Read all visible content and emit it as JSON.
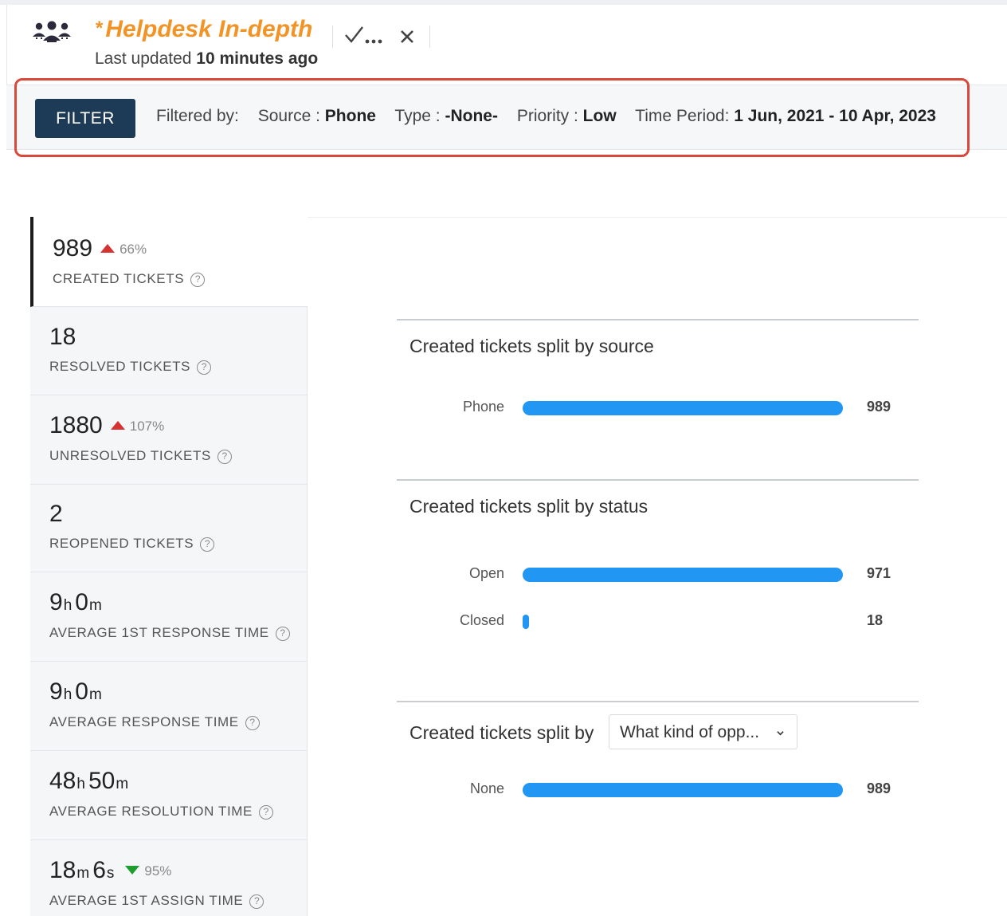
{
  "header": {
    "unsaved_marker": "*",
    "title": "Helpdesk In-depth",
    "updated_prefix": "Last updated",
    "updated_value": "10 minutes ago"
  },
  "filter": {
    "button_label": "FILTER",
    "filtered_by_label": "Filtered by:",
    "items": [
      {
        "label": "Source :",
        "value": "Phone"
      },
      {
        "label": "Type :",
        "value": "-None-"
      },
      {
        "label": "Priority :",
        "value": "Low"
      },
      {
        "label": "Time Period:",
        "value": "1 Jun, 2021 - 10 Apr, 2023"
      }
    ]
  },
  "metrics": [
    {
      "value": "989",
      "trend": "66%",
      "trend_dir": "up",
      "label": "CREATED TICKETS"
    },
    {
      "value": "18",
      "label": "RESOLVED TICKETS"
    },
    {
      "value": "1880",
      "trend": "107%",
      "trend_dir": "up",
      "label": "UNRESOLVED TICKETS"
    },
    {
      "value": "2",
      "label": "REOPENED TICKETS"
    },
    {
      "v1": "9",
      "u1": "h",
      "v2": "0",
      "u2": "m",
      "label": "AVERAGE 1ST RESPONSE TIME"
    },
    {
      "v1": "9",
      "u1": "h",
      "v2": "0",
      "u2": "m",
      "label": "AVERAGE RESPONSE TIME"
    },
    {
      "v1": "48",
      "u1": "h",
      "v2": "50",
      "u2": "m",
      "label": "AVERAGE RESOLUTION TIME"
    },
    {
      "v1": "18",
      "u1": "m",
      "v2": "6",
      "u2": "s",
      "trend": "95%",
      "trend_dir": "down",
      "label": "AVERAGE 1ST ASSIGN TIME"
    }
  ],
  "panels": [
    {
      "title": "Created tickets split by source",
      "rows": [
        {
          "label": "Phone",
          "value": 989,
          "display": "989"
        }
      ]
    },
    {
      "title": "Created tickets split by status",
      "rows": [
        {
          "label": "Open",
          "value": 971,
          "display": "971"
        },
        {
          "label": "Closed",
          "value": 18,
          "display": "18"
        }
      ]
    },
    {
      "title": "Created tickets split by",
      "dropdown": "What kind of opp...",
      "rows": [
        {
          "label": "None",
          "value": 989,
          "display": "989"
        }
      ]
    }
  ],
  "colors": {
    "accent": "#f39325",
    "bar": "#2196f3",
    "filter_button": "#1d3a56",
    "highlight": "#d9483b",
    "trend_up": "#d63232",
    "trend_down": "#1e9e2e"
  },
  "icons": [
    "team-logo-icon",
    "check-more-icon",
    "close-icon",
    "help-icon",
    "chevron-down-icon"
  ]
}
